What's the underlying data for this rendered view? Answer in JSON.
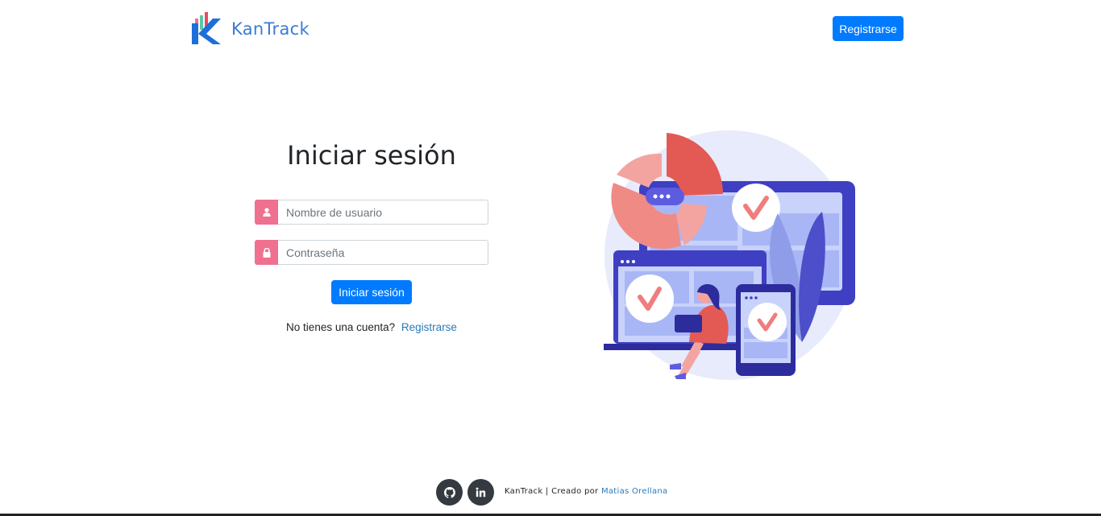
{
  "header": {
    "brand_name": "KanTrack",
    "register_button": "Registrarse"
  },
  "login": {
    "title": "Iniciar sesión",
    "username_placeholder": "Nombre de usuario",
    "password_placeholder": "Contraseña",
    "submit_label": "Iniciar sesión",
    "no_account_text": "No tienes una cuenta?",
    "register_link": "Registrarse",
    "icons": [
      "user-icon",
      "lock-icon"
    ]
  },
  "footer": {
    "brand": "KanTrack",
    "separator": "|",
    "created_by": "Creado por",
    "author": "Matias Orellana",
    "icons": [
      "github-icon",
      "linkedin-icon"
    ]
  },
  "colors": {
    "primary": "#007bff",
    "input_icon_bg": "#f07090",
    "link": "#2a7ab8",
    "brand_text": "#3a7bd5"
  }
}
